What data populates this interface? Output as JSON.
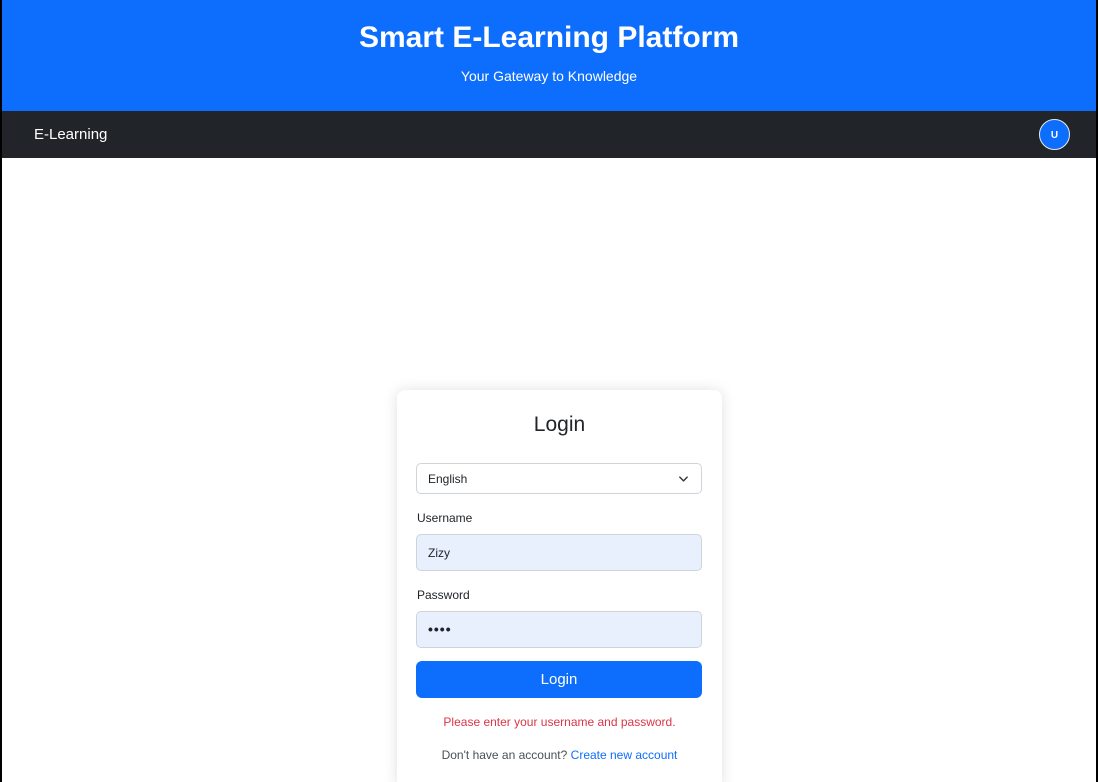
{
  "hero": {
    "title": "Smart E-Learning Platform",
    "subtitle": "Your Gateway to Knowledge"
  },
  "navbar": {
    "brand": "E-Learning",
    "avatar_initial": "U"
  },
  "login_card": {
    "title": "Login",
    "language_select": {
      "value": "English",
      "icon": "chevron-down-icon"
    },
    "username": {
      "label": "Username",
      "value": "Zizy"
    },
    "password": {
      "label": "Password",
      "masked_value": "••••"
    },
    "submit_label": "Login",
    "error_message": "Please enter your username and password.",
    "signup_prompt": "Don't have an account?",
    "signup_link": "Create new account"
  },
  "colors": {
    "primary": "#0d6efd",
    "navbar_bg": "#212529",
    "error": "#dc3545",
    "autofill_bg": "#e8f0fe"
  }
}
